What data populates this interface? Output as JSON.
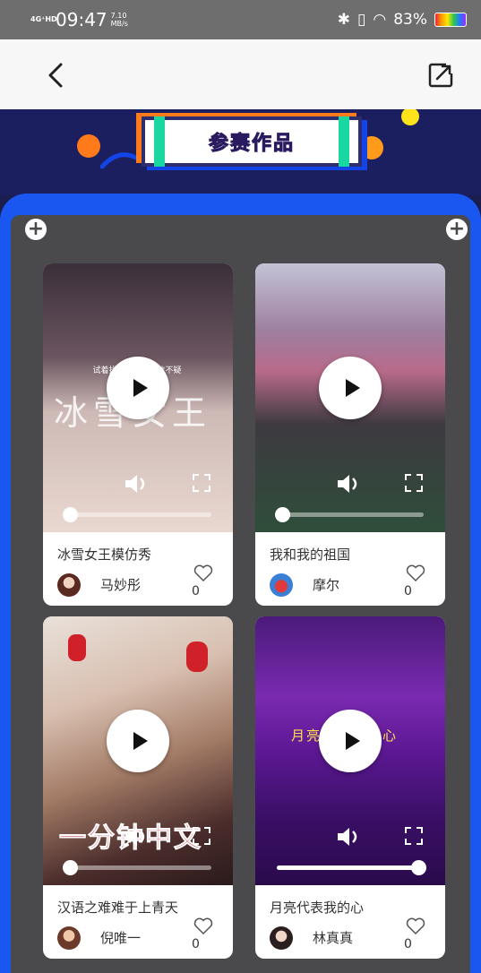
{
  "status_bar": {
    "network": "4G⁺HD",
    "time": "09:47",
    "net_speed": "7.10 MB/s",
    "battery": "83%"
  },
  "banner": {
    "title": "参赛作品"
  },
  "works": [
    {
      "title": "冰雪女王模仿秀",
      "author": "马妙彤",
      "likes": "0",
      "overlay_text": "冰雪女王",
      "caption": "试着找回回忆，相信不疑"
    },
    {
      "title": "我和我的祖国",
      "author": "摩尔",
      "likes": "0"
    },
    {
      "title": "汉语之难难于上青天",
      "author": "倪唯一",
      "likes": "0",
      "overlay_text": "一分钟中文"
    },
    {
      "title": "月亮代表我的心",
      "author": "林真真",
      "likes": "0",
      "overlay_text": "月亮代表我的心"
    }
  ],
  "colors": {
    "frame_blue": "#1a56f0",
    "inner_grey": "#4a4a4c",
    "banner_navy": "#1c1f5f",
    "title_pink": "#ff4d7a"
  },
  "icons": [
    "back-icon",
    "share-icon",
    "plus-icon",
    "play-icon",
    "volume-icon",
    "fullscreen-icon",
    "heart-icon"
  ]
}
